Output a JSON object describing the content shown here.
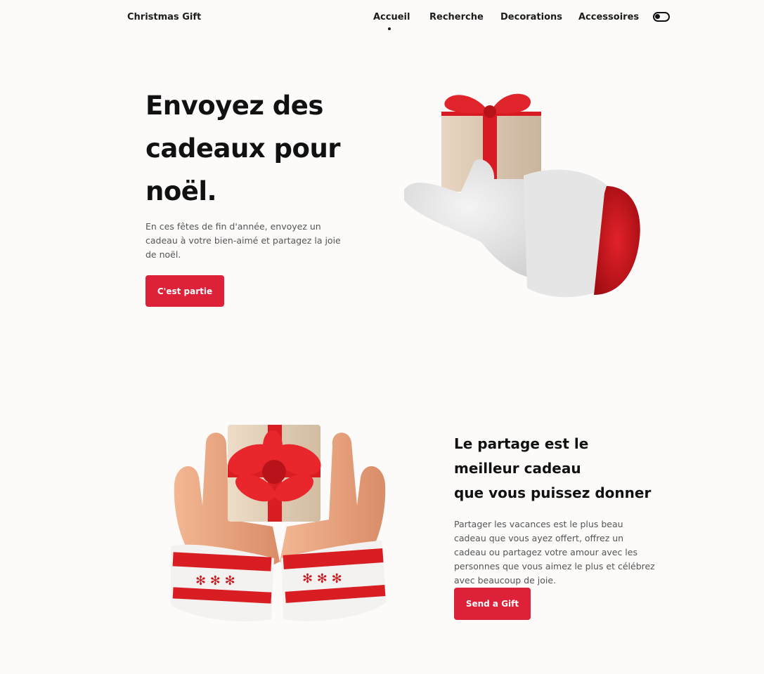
{
  "header": {
    "logo": "Christmas Gift",
    "nav": [
      {
        "label": "Accueil",
        "active": true
      },
      {
        "label": "Recherche",
        "active": false
      },
      {
        "label": "Decorations",
        "active": false
      },
      {
        "label": "Accessoires",
        "active": false
      }
    ],
    "theme_toggle_icon": "toggle-icon"
  },
  "hero": {
    "title_lines": [
      "Envoyez des",
      "cadeaux pour",
      "noël."
    ],
    "description": "En ces fêtes de fin d'année, envoyez un cadeau à votre bien-aimé et partagez la joie de noël.",
    "button_label": "C'est partie",
    "image": "glove-holding-gift-illustration"
  },
  "share": {
    "title_lines": [
      "Le partage est le",
      "meilleur cadeau",
      "que vous puissez donner"
    ],
    "description": "Partager les vacances est le plus beau cadeau que vous ayez offert, offrez un cadeau ou partagez votre amour avec les personnes que vous aimez le plus et célébrez avec beaucoup de joie.",
    "button_label": "Send a Gift",
    "image": "hands-holding-gift-illustration"
  },
  "colors": {
    "accent": "#dc2139",
    "background": "#fcfbfa",
    "text": "#111111"
  }
}
